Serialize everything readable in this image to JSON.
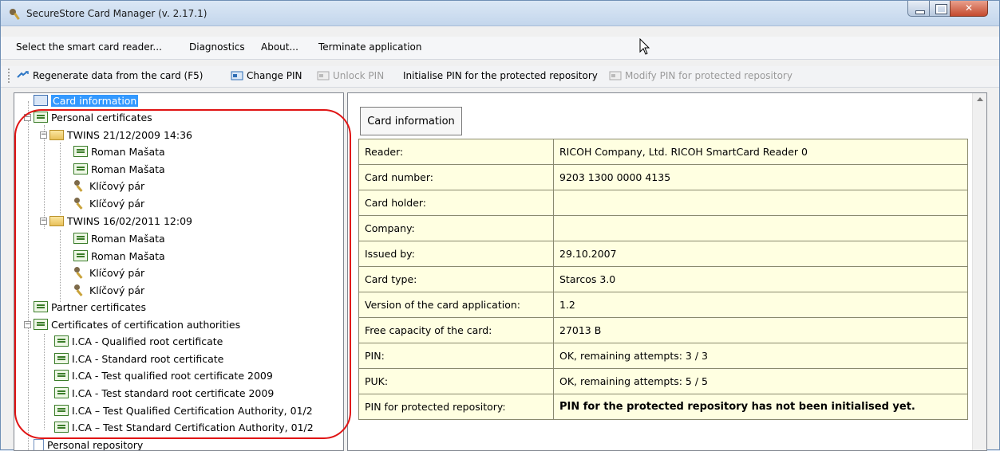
{
  "window": {
    "title": "SecureStore Card Manager (v. 2.17.1)"
  },
  "menu": [
    "Select the smart card reader...",
    "Diagnostics",
    "About...",
    "Terminate application"
  ],
  "toolbar": {
    "regenerate": "Regenerate data from the card (F5)",
    "change_pin": "Change PIN",
    "unlock_pin": "Unlock PIN",
    "init_pin": "Initialise PIN for the protected repository",
    "modify_pin": "Modify PIN for protected repository"
  },
  "tree": {
    "card_information": "Card information",
    "personal_certificates": "Personal certificates",
    "folder1": "TWINS 21/12/2009 14:36",
    "folder1_items": [
      "Roman Mašata",
      "Roman Mašata",
      "Klíčový pár",
      "Klíčový pár"
    ],
    "folder2": "TWINS 16/02/2011 12:09",
    "folder2_items": [
      "Roman Mašata",
      "Roman Mašata",
      "Klíčový pár",
      "Klíčový pár"
    ],
    "partner_certificates": "Partner certificates",
    "ca_certificates": "Certificates of certification authorities",
    "ca_items": [
      "I.CA - Qualified root certificate",
      "I.CA - Standard root certificate",
      "I.CA - Test qualified root certificate 2009",
      "I.CA - Test standard root certificate 2009",
      "I.CA – Test Qualified Certification Authority, 01/2",
      "I.CA – Test Standard Certification Authority, 01/2"
    ],
    "personal_repository": "Personal repository"
  },
  "details": {
    "caption": "Card information",
    "rows": [
      {
        "label": "Reader:",
        "value": "RICOH Company, Ltd. RICOH SmartCard Reader 0"
      },
      {
        "label": "Card number:",
        "value": "9203 1300 0000 4135"
      },
      {
        "label": "Card holder:",
        "value": ""
      },
      {
        "label": "Company:",
        "value": ""
      },
      {
        "label": "Issued by:",
        "value": "29.10.2007"
      },
      {
        "label": "Card type:",
        "value": "Starcos 3.0"
      },
      {
        "label": "Version of the card application:",
        "value": "1.2"
      },
      {
        "label": "Free capacity of the card:",
        "value": "27013 B"
      },
      {
        "label": "PIN:",
        "value": "OK, remaining attempts: 3 / 3"
      },
      {
        "label": "PUK:",
        "value": "OK, remaining attempts: 5 / 5"
      },
      {
        "label": "PIN for protected repository:",
        "value": "PIN for the protected repository has not been initialised yet."
      }
    ]
  },
  "colors": {
    "selection": "#3399ff",
    "table_bg": "#ffffe1",
    "highlight": "#e01414"
  }
}
